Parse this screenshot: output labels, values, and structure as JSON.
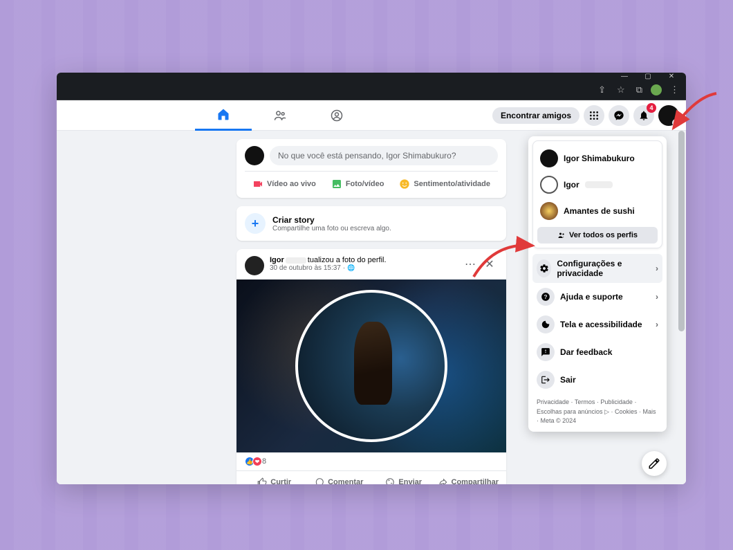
{
  "browser": {
    "window_buttons": [
      "minimize",
      "maximize",
      "close"
    ]
  },
  "header": {
    "find_friends": "Encontrar amigos",
    "notification_count": "4"
  },
  "composer": {
    "placeholder": "No que você está pensando, Igor Shimabukuro?",
    "live_video": "Vídeo ao vivo",
    "photo_video": "Foto/vídeo",
    "feeling": "Sentimento/atividade"
  },
  "story": {
    "title": "Criar story",
    "subtitle": "Compartilhe uma foto ou escreva algo."
  },
  "post": {
    "author": "Igor",
    "suffix": "tualizou a foto do perfil.",
    "time": "30 de outubro às 15:37",
    "reaction_count": "8",
    "like": "Curtir",
    "comment": "Comentar",
    "send": "Enviar",
    "share": "Compartilhar"
  },
  "dropdown": {
    "profile_name": "Igor Shimabukuro",
    "alt1": "Igor",
    "alt2": "Amantes de sushi",
    "see_all": "Ver todos os perfis",
    "settings": "Configurações e privacidade",
    "help": "Ajuda e suporte",
    "display": "Tela e acessibilidade",
    "feedback": "Dar feedback",
    "logout": "Sair",
    "footer": {
      "privacy": "Privacidade",
      "terms": "Termos",
      "ads": "Publicidade",
      "choices": "Escolhas para anúncios",
      "cookies": "Cookies",
      "more": "Mais",
      "meta": "Meta © 2024"
    }
  }
}
